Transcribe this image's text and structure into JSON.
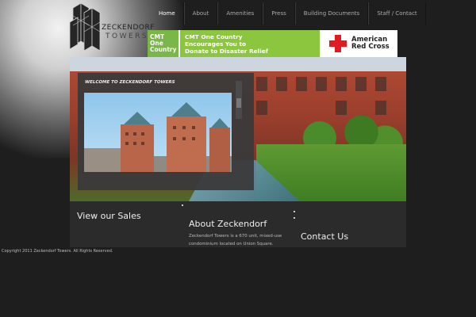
{
  "brand": {
    "line1": "ZECKENDORF",
    "line2": "TOWERS"
  },
  "nav": [
    {
      "label": "Home",
      "active": true
    },
    {
      "label": "About",
      "active": false
    },
    {
      "label": "Amenities",
      "active": false
    },
    {
      "label": "Press",
      "active": false
    },
    {
      "label": "Building Documents",
      "active": false
    },
    {
      "label": "Staff / Contact",
      "active": false
    }
  ],
  "banner": {
    "cmt_logo": [
      "CMT",
      "One",
      "Country"
    ],
    "headline_lines": [
      "CMT One Country",
      "Encourages You to",
      "Donate to Disaster Relief"
    ],
    "partner_lines": [
      "American",
      "Red Cross"
    ]
  },
  "welcome": {
    "title": "WELCOME TO ZECKENDORF TOWERS"
  },
  "sections": {
    "sales": {
      "title": "View our Sales"
    },
    "about": {
      "title": "About Zeckendorf",
      "text": "Zeckendorf Towers is a 670 unit, mixed-use condominium located on Union Square."
    },
    "contact": {
      "title": "Contact Us"
    }
  },
  "footer": {
    "copyright": "Copyright 2011 Zeckendorf Towers. All Rights Reserved."
  },
  "colors": {
    "cmt_green": "#8cc63f",
    "red_cross": "#e21b23",
    "panel": "#2b2b2b"
  }
}
